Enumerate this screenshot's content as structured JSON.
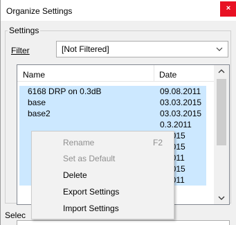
{
  "window": {
    "title": "Organize Settings",
    "close_glyph": "×"
  },
  "settings_group": {
    "label": "Settings",
    "filter_label": "Filter",
    "filter_value": "[Not Filtered]"
  },
  "list": {
    "columns": {
      "name": "Name",
      "date": "Date"
    },
    "rows": [
      {
        "name": "6168 DRP on 0.3dB",
        "date": "09.08.2011"
      },
      {
        "name": "base",
        "date": "03.03.2015"
      },
      {
        "name": "base2",
        "date": "03.03.2015"
      },
      {
        "name": "",
        "date": "0.3.2011"
      },
      {
        "name": "",
        "date": "5.2015"
      },
      {
        "name": "",
        "date": "5.2015"
      },
      {
        "name": "",
        "date": "5.2011"
      },
      {
        "name": "",
        "date": "2.2015"
      },
      {
        "name": "",
        "date": "2.2011"
      }
    ],
    "selection_color": "#cce8ff"
  },
  "selection_label": "Selec",
  "context_menu": {
    "items": [
      {
        "label": "Rename",
        "shortcut": "F2",
        "enabled": false
      },
      {
        "label": "Set as Default",
        "shortcut": "",
        "enabled": false
      },
      {
        "label": "Delete",
        "shortcut": "",
        "enabled": true
      },
      {
        "label": "Export Settings",
        "shortcut": "",
        "enabled": true
      },
      {
        "label": "Import Settings",
        "shortcut": "",
        "enabled": true
      }
    ]
  },
  "colors": {
    "close_button": "#e81123",
    "dialog_background": "#f0f0f0",
    "menu_background": "#f2f2f2",
    "disabled_text": "#8f8f8f"
  }
}
